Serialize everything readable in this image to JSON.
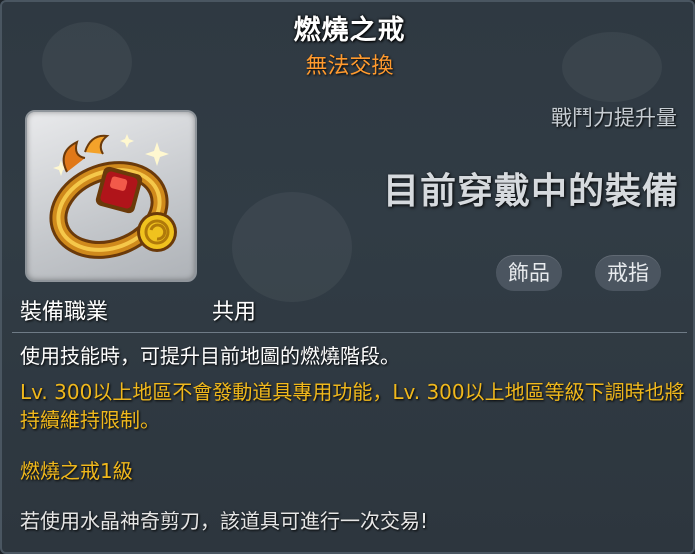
{
  "item": {
    "name": "燃燒之戒",
    "trade_status": "無法交換",
    "power_label": "戰鬥力提升量",
    "equipped_text": "目前穿戴中的裝備",
    "tags": [
      "飾品",
      "戒指"
    ],
    "job_label": "裝備職業",
    "job_value": "共用",
    "description": "使用技能時，可提升目前地圖的燃燒階段。",
    "restriction": "Lv. 300以上地區不會發動道具專用功能，Lv. 300以上地區等級下調時也將持續維持限制。",
    "level_text": "燃燒之戒1級",
    "scissors_note": "若使用水晶神奇剪刀，該道具可進行一次交易!"
  },
  "icons": {
    "item_icon": "burning-ring-icon"
  },
  "colors": {
    "title": "#ffffff",
    "trade_status": "#ff9a2e",
    "highlight": "#f0b81c",
    "background": "#2f3942"
  }
}
